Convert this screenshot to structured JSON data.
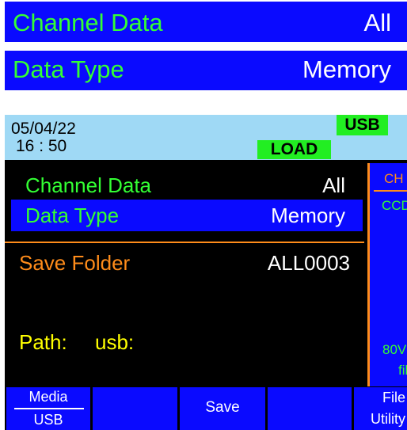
{
  "top_bars": {
    "channel_data": {
      "label": "Channel Data",
      "value": "All"
    },
    "data_type": {
      "label": "Data Type",
      "value": "Memory"
    }
  },
  "status": {
    "date": "05/04/22",
    "time": "16 : 50",
    "usb_badge": "USB",
    "load_badge": "LOAD"
  },
  "dialog": {
    "channel_data": {
      "label": "Channel Data",
      "value": "All"
    },
    "data_type": {
      "label": "Data Type",
      "value": "Memory"
    },
    "save_folder": {
      "label": "Save Folder",
      "value": "ALL0003"
    },
    "path": {
      "label": "Path:",
      "value": "usb:"
    }
  },
  "right_panel": {
    "tab": "CH",
    "mode": "CCD",
    "voltage": "80V",
    "file": "file"
  },
  "softkeys": {
    "media": {
      "top": "Media",
      "bottom": "USB"
    },
    "save": "Save",
    "file_utility": {
      "top": "File",
      "bottom": "Utility"
    }
  },
  "colors": {
    "accent_blue": "#0a0aff",
    "label_green": "#33ff33",
    "orange": "#ff8c1a",
    "yellow": "#ffff00",
    "status_bar": "#9fd9f5",
    "badge_green": "#22ee22"
  }
}
